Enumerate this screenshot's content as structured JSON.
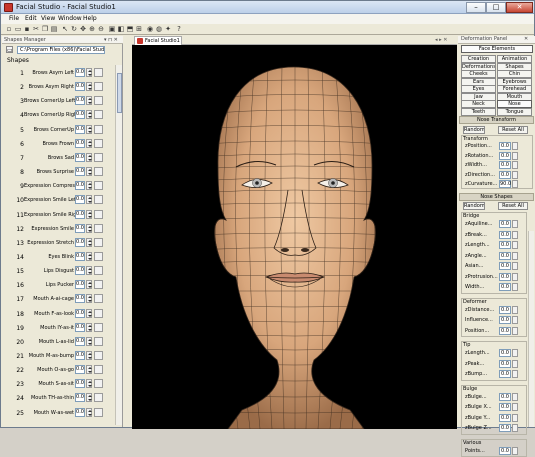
{
  "window": {
    "title": "Facial Studio - Facial Studio1"
  },
  "menubar": {
    "items": [
      "File",
      "Edit",
      "View",
      "Window",
      "Help"
    ]
  },
  "shapes_manager": {
    "header": "Shapes Manager",
    "path": "C:\\Program Files (x86)\\Facial Studio 6",
    "shapes_label": "Shapes",
    "rows": [
      {
        "num": "1",
        "name": "Brows Asym Left",
        "value": "0.0"
      },
      {
        "num": "2",
        "name": "Brows Asym Right",
        "value": "0.0"
      },
      {
        "num": "3",
        "name": "Brows CornerUp Left",
        "value": "0.0"
      },
      {
        "num": "4",
        "name": "Brows CornerUp Right",
        "value": "0.0"
      },
      {
        "num": "5",
        "name": "Brows CornerUp",
        "value": "0.0"
      },
      {
        "num": "6",
        "name": "Brows Frown",
        "value": "0.0"
      },
      {
        "num": "7",
        "name": "Brows Sad",
        "value": "0.0"
      },
      {
        "num": "8",
        "name": "Brows Surprise",
        "value": "0.0"
      },
      {
        "num": "9",
        "name": "Expression Compress",
        "value": "0.0"
      },
      {
        "num": "10",
        "name": "Expression Smile Left",
        "value": "0.0"
      },
      {
        "num": "11",
        "name": "Expression Smile Right",
        "value": "0.0"
      },
      {
        "num": "12",
        "name": "Expression Smile",
        "value": "0.0"
      },
      {
        "num": "13",
        "name": "Expression Stretch",
        "value": "0.0"
      },
      {
        "num": "14",
        "name": "Eyes Blink",
        "value": "0.0"
      },
      {
        "num": "15",
        "name": "Lips Disgust",
        "value": "0.0"
      },
      {
        "num": "16",
        "name": "Lips Pucker",
        "value": "0.0"
      },
      {
        "num": "17",
        "name": "Mouth A-ai-cage",
        "value": "0.0"
      },
      {
        "num": "18",
        "name": "Mouth F-as-look",
        "value": "0.0"
      },
      {
        "num": "19",
        "name": "Mouth IY-as-it",
        "value": "0.0"
      },
      {
        "num": "20",
        "name": "Mouth L-as-lid",
        "value": "0.0"
      },
      {
        "num": "21",
        "name": "Mouth M-as-bump",
        "value": "0.0"
      },
      {
        "num": "22",
        "name": "Mouth O-as-go",
        "value": "0.0"
      },
      {
        "num": "23",
        "name": "Mouth S-as-sit",
        "value": "0.0"
      },
      {
        "num": "24",
        "name": "Mouth TH-as-thin",
        "value": "0.0"
      },
      {
        "num": "25",
        "name": "Mouth W-as-wet",
        "value": "0.0"
      }
    ]
  },
  "viewport": {
    "tab": "Facial Studio1"
  },
  "deformation_panel": {
    "header": "Deformation Panel",
    "face_elements": "Face Elements",
    "buttons": [
      [
        "Creation",
        "Animation"
      ],
      [
        "Deformations",
        "Shapes"
      ],
      [
        "Cheeks",
        "Chin"
      ],
      [
        "Ears",
        "Eyebrows"
      ],
      [
        "Eyes",
        "Forehead"
      ],
      [
        "Jaw",
        "Mouth"
      ],
      [
        "Neck",
        "Nose"
      ],
      [
        "Teeth",
        "Tongue"
      ]
    ],
    "nose_transform": {
      "title": "Nose Transform",
      "random": "Random",
      "reset": "Reset All",
      "group": "Transform",
      "params": [
        {
          "label": "zPosition...",
          "value": "0.0"
        },
        {
          "label": "zRotation...",
          "value": "0.0"
        },
        {
          "label": "zWidth...",
          "value": "0.0"
        },
        {
          "label": "zDirection...",
          "value": "0.0"
        },
        {
          "label": "zCurvature...",
          "value": "90.0"
        }
      ]
    },
    "nose_shapes": {
      "title": "Nose Shapes",
      "random": "Random",
      "reset": "Reset All",
      "bridge": {
        "label": "Bridge",
        "params": [
          {
            "label": "zAquiline...",
            "value": "0.0"
          },
          {
            "label": "zBreak...",
            "value": "0.0"
          },
          {
            "label": "zLength...",
            "value": "0.0"
          },
          {
            "label": "zAngle...",
            "value": "0.0"
          },
          {
            "label": "Asian...",
            "value": "0.0"
          },
          {
            "label": "zProtrusion...",
            "value": "0.0"
          },
          {
            "label": "Width...",
            "value": "0.0"
          }
        ]
      },
      "deformer": {
        "label": "Deformer",
        "params": [
          {
            "label": "zDistance...",
            "value": "0.0"
          },
          {
            "label": "Influence...",
            "value": "0.0"
          },
          {
            "label": "Position...",
            "value": "0.0"
          }
        ]
      },
      "tip": {
        "label": "Tip",
        "params": [
          {
            "label": "zLength...",
            "value": "0.0"
          },
          {
            "label": "zPeak...",
            "value": "0.0"
          },
          {
            "label": "zBump...",
            "value": "0.0"
          }
        ]
      },
      "bulge": {
        "label": "Bulge",
        "params": [
          {
            "label": "zBulge...",
            "value": "0.0"
          },
          {
            "label": "zBulge X...",
            "value": "0.0"
          },
          {
            "label": "zBulge Y...",
            "value": "0.0"
          },
          {
            "label": "zBulge Z...",
            "value": "0.0"
          }
        ]
      },
      "various": {
        "label": "Various",
        "params": [
          {
            "label": "Points...",
            "value": "0.0"
          }
        ]
      }
    }
  },
  "colors": {
    "viewport_bg": "#000000",
    "skin": "#d9ad84",
    "mesh": "#3a2a1e"
  }
}
